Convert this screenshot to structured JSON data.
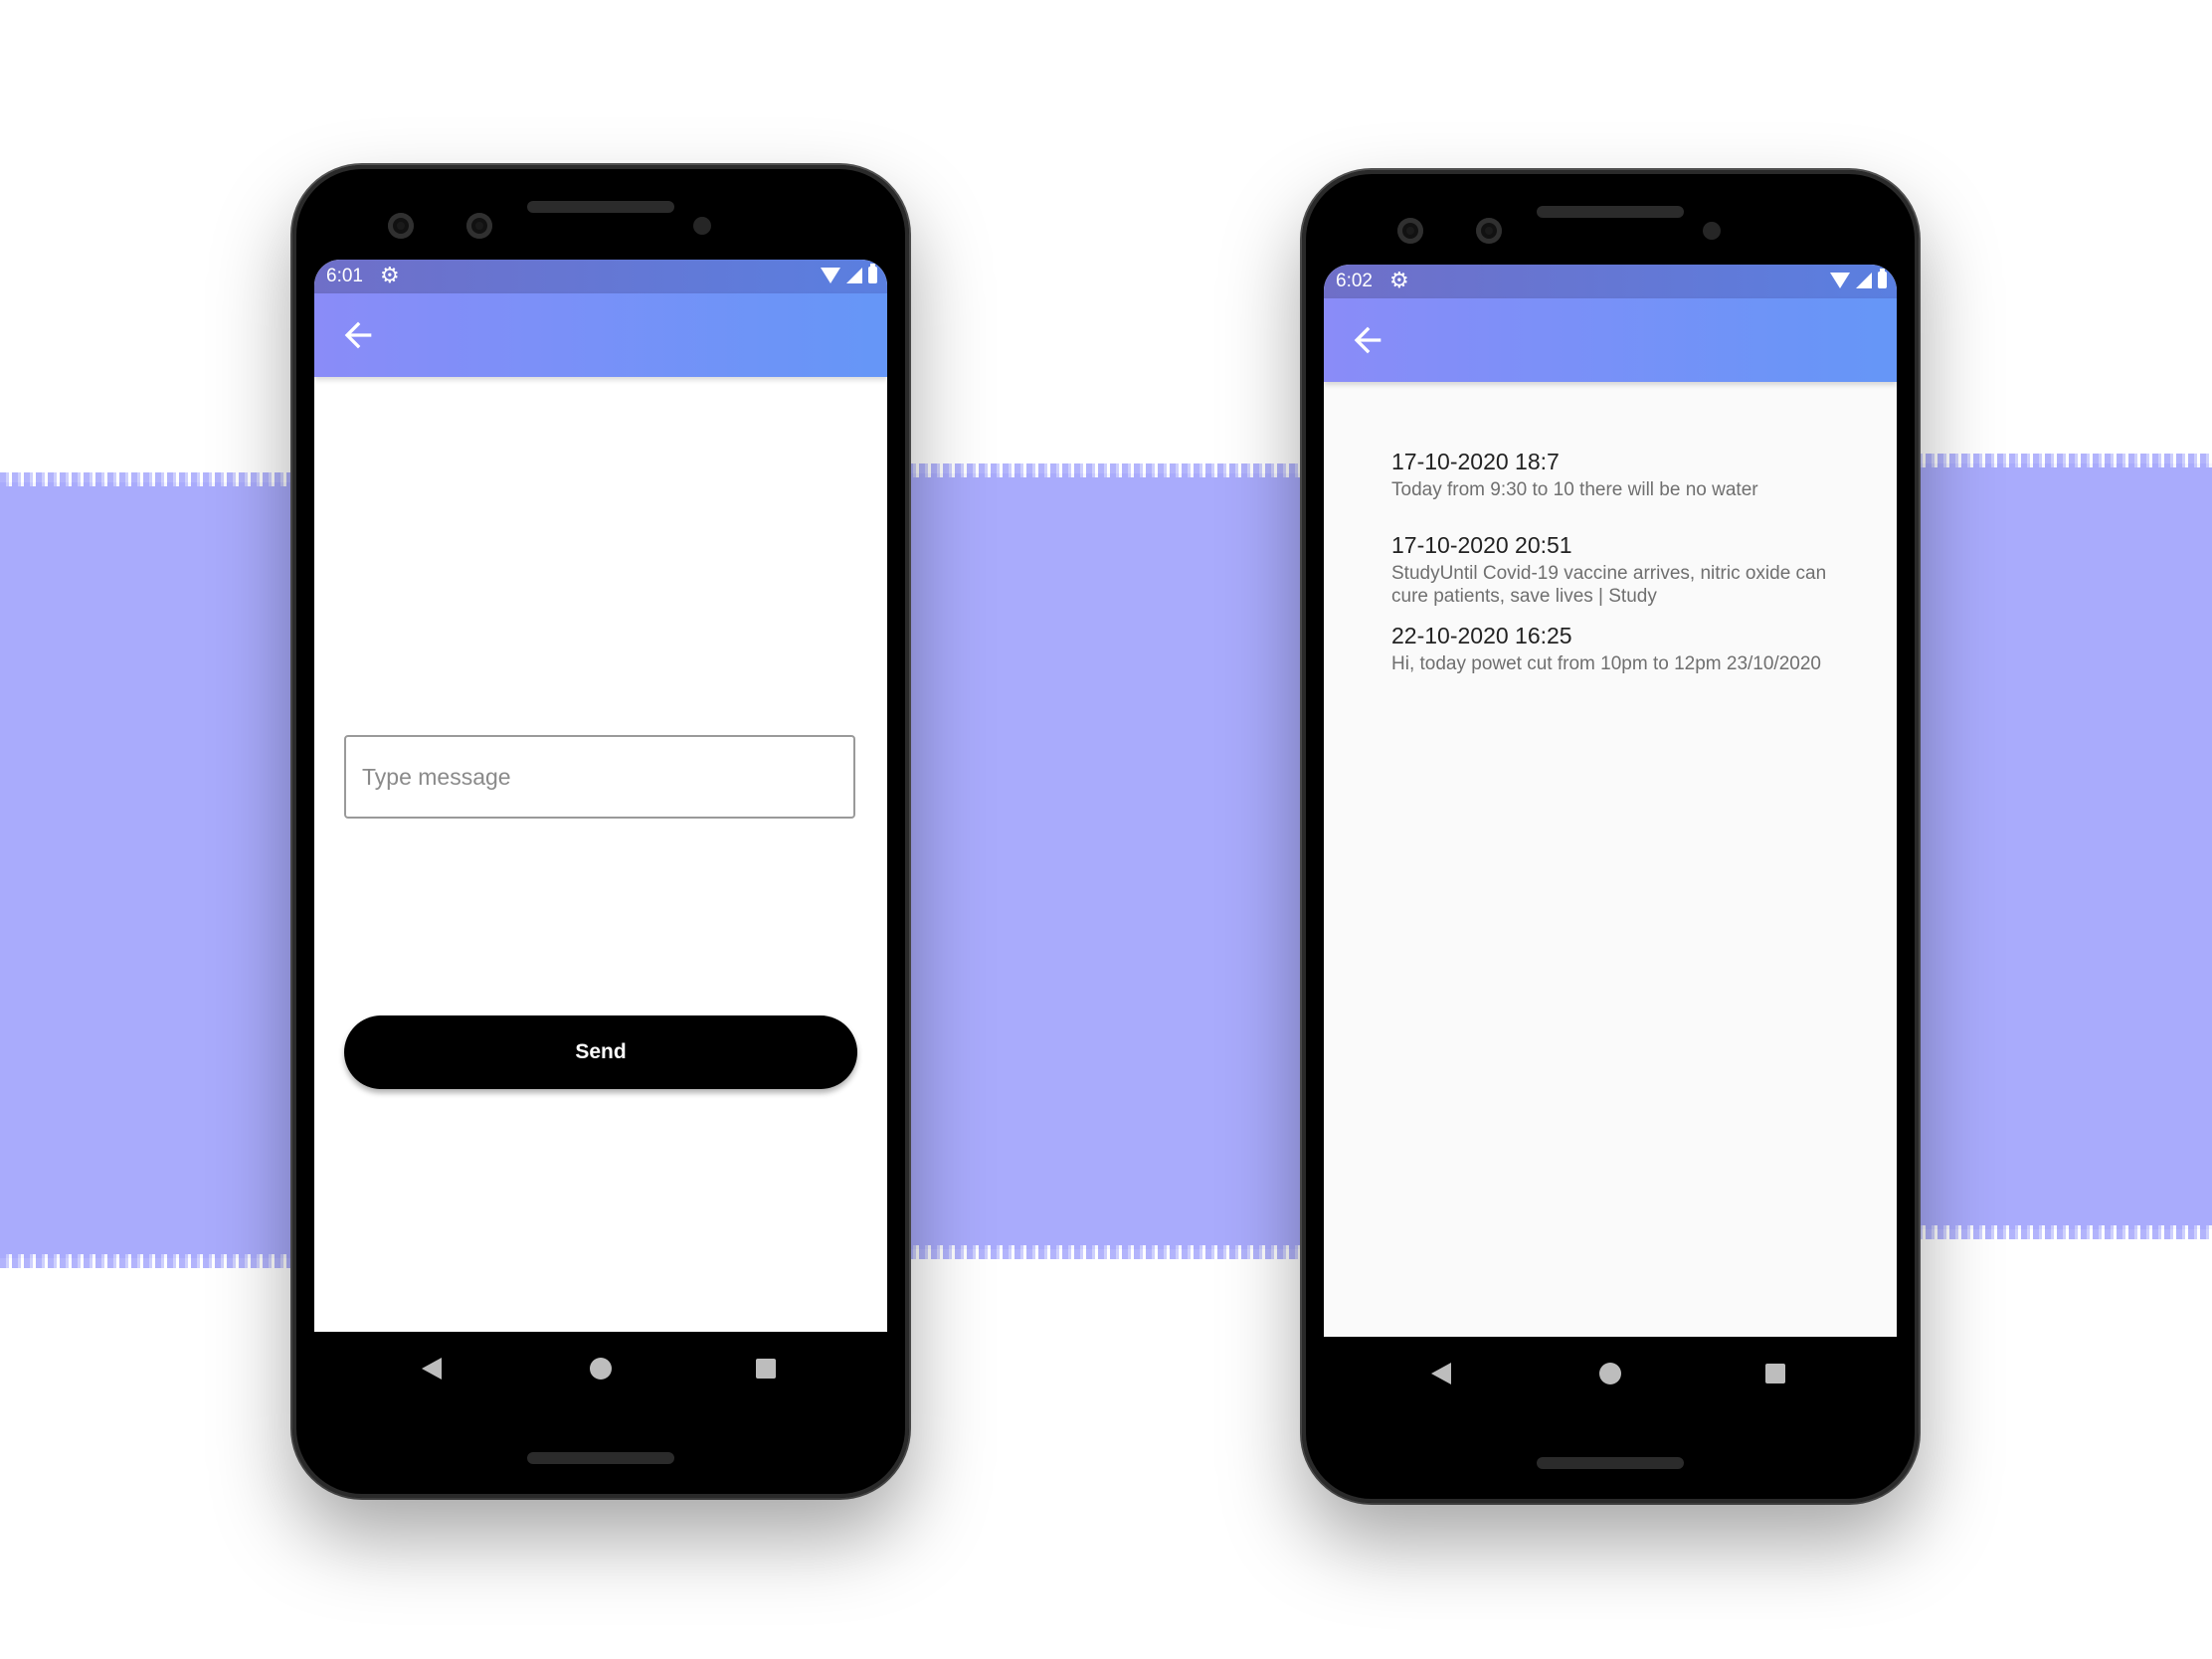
{
  "colors": {
    "stripe": "#a9abfc",
    "appbar_start": "#8a8cf8",
    "appbar_end": "#6596f7",
    "send_button": "#000000"
  },
  "compose_screen": {
    "status_time": "6:01",
    "message_placeholder": "Type message",
    "message_value": "",
    "send_label": "Send",
    "icons": [
      "gear-icon",
      "wifi-icon",
      "signal-icon",
      "battery-icon",
      "back-arrow-icon"
    ]
  },
  "notices_screen": {
    "status_time": "6:02",
    "notices": [
      {
        "date": "17-10-2020 18:7",
        "text": "Today from 9:30 to 10 there will be no water"
      },
      {
        "date": "17-10-2020 20:51",
        "text": "StudyUntil Covid-19 vaccine arrives, nitric oxide can cure patients, save lives | Study"
      },
      {
        "date": "22-10-2020 16:25",
        "text": "Hi, today powet cut from 10pm to 12pm 23/10/2020"
      }
    ]
  },
  "navigation": {
    "icons": [
      "nav-back-icon",
      "nav-home-icon",
      "nav-recents-icon"
    ]
  }
}
